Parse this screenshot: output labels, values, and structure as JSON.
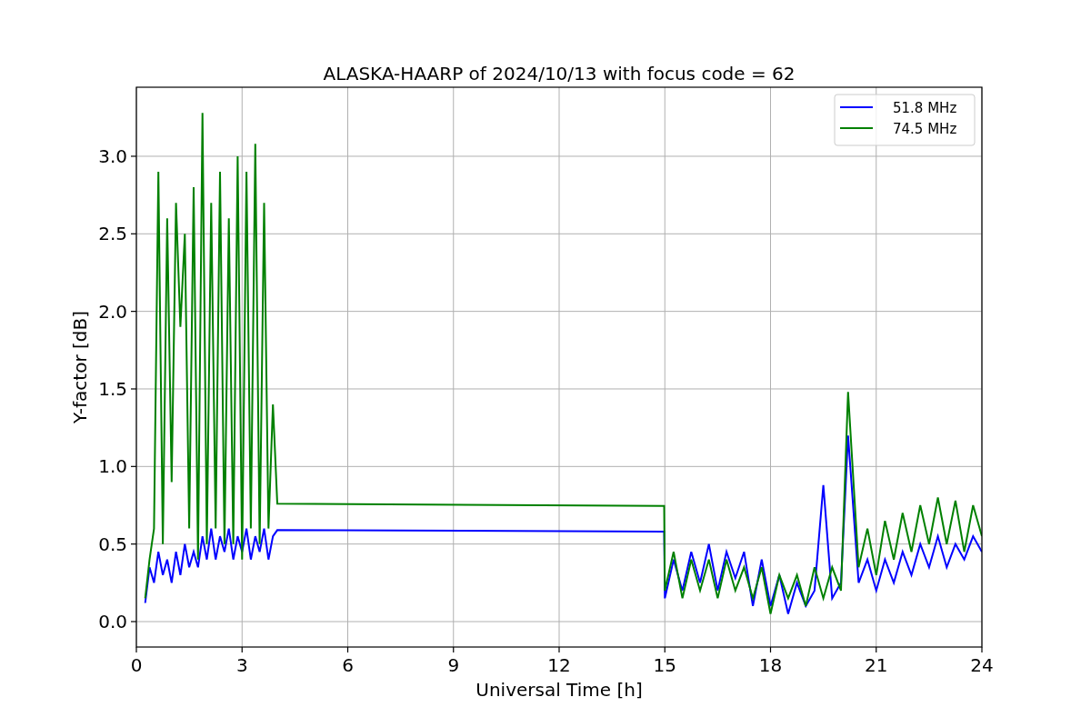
{
  "chart_data": {
    "type": "line",
    "title": "ALASKA-HAARP of 2024/10/13 with focus code = 62",
    "xlabel": "Universal Time [h]",
    "ylabel": "Y-factor [dB]",
    "x": [
      0.25,
      0.375,
      0.5,
      0.625,
      0.75,
      0.875,
      1,
      1.125,
      1.25,
      1.375,
      1.5,
      1.625,
      1.75,
      1.875,
      2,
      2.125,
      2.25,
      2.375,
      2.5,
      2.625,
      2.75,
      2.875,
      3,
      3.125,
      3.25,
      3.375,
      3.5,
      3.625,
      3.75,
      3.875,
      4,
      14.98,
      15,
      15.25,
      15.5,
      15.75,
      16,
      16.25,
      16.5,
      16.75,
      17,
      17.25,
      17.5,
      17.75,
      18,
      18.25,
      18.5,
      18.75,
      19,
      19.25,
      19.5,
      19.75,
      20,
      20.2,
      20.5,
      20.75,
      21,
      21.25,
      21.5,
      21.75,
      22,
      22.25,
      22.5,
      22.75,
      23,
      23.25,
      23.5,
      23.75,
      24
    ],
    "series": [
      {
        "name": "51.8 MHz",
        "color": "#0000ff",
        "values": [
          0.12,
          0.35,
          0.25,
          0.45,
          0.3,
          0.4,
          0.25,
          0.45,
          0.3,
          0.5,
          0.35,
          0.45,
          0.35,
          0.55,
          0.4,
          0.6,
          0.4,
          0.55,
          0.45,
          0.6,
          0.4,
          0.55,
          0.45,
          0.6,
          0.4,
          0.55,
          0.45,
          0.6,
          0.4,
          0.55,
          0.59,
          0.58,
          0.15,
          0.4,
          0.2,
          0.45,
          0.25,
          0.5,
          0.2,
          0.45,
          0.28,
          0.45,
          0.1,
          0.4,
          0.1,
          0.3,
          0.05,
          0.25,
          0.1,
          0.2,
          0.88,
          0.15,
          0.25,
          1.2,
          0.25,
          0.4,
          0.2,
          0.4,
          0.25,
          0.45,
          0.3,
          0.5,
          0.35,
          0.55,
          0.35,
          0.5,
          0.4,
          0.55,
          0.45
        ]
      },
      {
        "name": "74.5 MHz",
        "color": "#008000",
        "values": [
          0.15,
          0.4,
          0.6,
          2.9,
          0.5,
          2.6,
          0.9,
          2.7,
          1.9,
          2.5,
          0.6,
          2.8,
          0.4,
          3.28,
          0.5,
          2.7,
          0.6,
          2.9,
          0.5,
          2.6,
          0.5,
          3.0,
          0.4,
          2.9,
          0.6,
          3.08,
          0.5,
          2.7,
          0.6,
          1.4,
          0.76,
          0.745,
          0.2,
          0.45,
          0.15,
          0.4,
          0.2,
          0.4,
          0.15,
          0.4,
          0.2,
          0.35,
          0.15,
          0.35,
          0.05,
          0.3,
          0.15,
          0.3,
          0.1,
          0.35,
          0.15,
          0.35,
          0.2,
          1.48,
          0.35,
          0.6,
          0.3,
          0.65,
          0.4,
          0.7,
          0.45,
          0.75,
          0.5,
          0.8,
          0.5,
          0.78,
          0.45,
          0.75,
          0.55
        ]
      }
    ],
    "grid": true,
    "legend": "upper right",
    "xlim": [
      0,
      24
    ],
    "ylim": [
      -0.164,
      3.445
    ],
    "xticks": [
      0,
      3,
      6,
      9,
      12,
      15,
      18,
      21,
      24
    ],
    "yticks": [
      {
        "value": 0,
        "label": "0.0"
      },
      {
        "value": 0.5,
        "label": "0.5"
      },
      {
        "value": 1,
        "label": "1.0"
      },
      {
        "value": 1.5,
        "label": "1.5"
      },
      {
        "value": 2,
        "label": "2.0"
      },
      {
        "value": 2.5,
        "label": "2.5"
      },
      {
        "value": 3,
        "label": "3.0"
      }
    ]
  }
}
